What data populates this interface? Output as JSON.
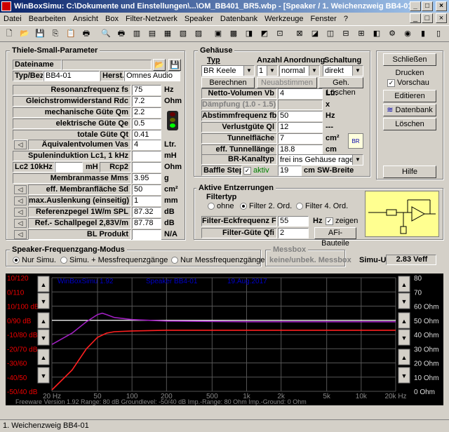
{
  "window": {
    "title": "WinBoxSimu: C:\\Dokumente und Einstellungen\\...\\OM_BB401_BR5.wbp - [Speaker / 1. Weichenzweig BB4-01]"
  },
  "menu": [
    "Datei",
    "Bearbeiten",
    "Ansicht",
    "Box",
    "Filter-Netzwerk",
    "Speaker",
    "Datenbank",
    "Werkzeuge",
    "Fenster",
    "?"
  ],
  "ts": {
    "title": "Thiele-Small-Parameter",
    "dateiname_label": "Dateiname",
    "typ_label": "Typ/Bez.",
    "typ_value": "BB4-01",
    "herst_label": "Herst.",
    "herst_value": "Omnes Audio",
    "rows": [
      {
        "label": "Resonanzfrequenz fs",
        "value": "75",
        "unit": "Hz"
      },
      {
        "label": "Gleichstromwiderstand Rdc",
        "value": "7.2",
        "unit": "Ohm"
      },
      {
        "label": "mechanische Güte Qm",
        "value": "2.2",
        "unit": ""
      },
      {
        "label": "elektrische Güte Qe",
        "value": "0.5",
        "unit": ""
      },
      {
        "label": "totale Güte Qt",
        "value": "0.41",
        "unit": ""
      },
      {
        "label": "Äquivalentvolumen Vas",
        "value": "4",
        "unit": "Ltr."
      },
      {
        "label": "Spuleninduktion  Lc1, 1 kHz",
        "value": "",
        "unit": "mH"
      },
      {
        "label": "Membranmasse Mms",
        "value": "3.95",
        "unit": "g"
      },
      {
        "label": "eff. Membranfläche  Sd",
        "value": "50",
        "unit": "cm²"
      },
      {
        "label": "max.Auslenkung (einseitig) Xmax.",
        "value": "1",
        "unit": "mm"
      },
      {
        "label": "Referenzpegel 1W/m SPL",
        "value": "87.32",
        "unit": "dB"
      },
      {
        "label": "Ref.- Schallpegel 2,83V/m",
        "value": "87.78",
        "unit": "dB"
      },
      {
        "label": "BL Produkt",
        "value": "",
        "unit": "N/A"
      }
    ],
    "lc2_label": "Lc2 10kHz",
    "lc2_unit": "mH",
    "rcp2_label": "Rcp2",
    "rcp2_unit": "Ohm"
  },
  "gh": {
    "title": "Gehäuse",
    "typ_label": "Typ",
    "anzahl_label": "Anzahl",
    "anordnung_label": "Anordnung",
    "schaltung_label": "Schaltung",
    "typ_value": "BR Keele teilak",
    "anzahl_value": "1",
    "anordnung_value": "normal",
    "schaltung_value": "direkt",
    "berechnen": "Berechnen",
    "neuabstimmen": "Neuabstimmen",
    "loeschen": "Geh. Löschen",
    "rows": [
      {
        "label": "Netto-Volumen Vb",
        "value": "4",
        "unit": "Ltr."
      },
      {
        "label": "Dämpfung (1.0 - 1.5)",
        "value": "",
        "unit": "x"
      },
      {
        "label": "Abstimmfrequenz fb",
        "value": "50",
        "unit": "Hz"
      },
      {
        "label": "Verlustgüte Ql",
        "value": "12",
        "unit": "---"
      },
      {
        "label": "Tunnelfläche",
        "value": "7",
        "unit": "cm²"
      },
      {
        "label": "eff. Tunnellänge",
        "value": "18.8",
        "unit": "cm"
      }
    ],
    "kanaltyp_label": "BR-Kanaltyp",
    "kanaltyp_value": "frei ins Gehäuse ragend",
    "baffle_label": "Baffle Step",
    "aktiv_label": "aktiv",
    "baffle_value": "19",
    "baffle_unit": "cm SW-Breite"
  },
  "side": {
    "schliessen": "Schließen",
    "drucken": "Drucken",
    "vorschau": "Vorschau",
    "editieren": "Editieren",
    "datenbank": "Datenbank",
    "loeschen": "Löschen",
    "hilfe": "Hilfe"
  },
  "ae": {
    "title": "Aktive Entzerrungen",
    "filtertyp": "Filtertyp",
    "opts": [
      "ohne",
      "Filter 2. Ord.",
      "Filter 4. Ord."
    ],
    "eck_label": "Filter-Eckfrequenz Ffi",
    "eck_value": "55",
    "eck_unit": "Hz",
    "zeigen": "zeigen",
    "guete_label": "Filter-Güte Qfi",
    "guete_value": "2",
    "afi": "AFi-Bauteile"
  },
  "mode": {
    "title": "Speaker-Frequenzgang-Modus",
    "opts": [
      "Nur Simu.",
      "Simu. + Messfrequenzgänge",
      "Nur Messfrequenzgänge"
    ],
    "messbox_title": "Messbox",
    "messbox_value": "keine/unbek. Messbox",
    "simu_label": "Simu-U",
    "simu_value": "2.83 Veff"
  },
  "chart_data": {
    "type": "line",
    "title": "WinBoxSimu 1.92",
    "speaker_label": "Speaker BB4-01",
    "date": "19.Aug.2017",
    "x_ticks": [
      "20 Hz",
      "50",
      "100",
      "200",
      "500",
      "1k",
      "2k",
      "5k",
      "10k",
      "20k Hz"
    ],
    "x_tick_values": [
      20,
      50,
      100,
      200,
      500,
      1000,
      2000,
      5000,
      10000,
      20000
    ],
    "y_left_ticks": [
      "10/120",
      "0/110",
      "10/100 dB",
      "0/90 dB",
      "-10/80 dB",
      "-20/70 dB",
      "-30/60",
      "-40/50",
      "-50/40 dB"
    ],
    "y_right_ticks": [
      "80",
      "70",
      "60 Ohm",
      "50 Ohm",
      "40 Ohm",
      "30 Ohm",
      "20 Ohm",
      "10 Ohm",
      "0 Ohm"
    ],
    "xlim": [
      20,
      20000
    ],
    "ylim": [
      40,
      120
    ],
    "series": [
      {
        "color": "#ff2020",
        "x": [
          20,
          30,
          40,
          50,
          60,
          70,
          100,
          200,
          500,
          1000,
          20000
        ],
        "y": [
          41,
          55,
          70,
          78,
          81,
          82,
          82.5,
          83,
          83,
          83,
          83
        ]
      },
      {
        "color": "#a020c0",
        "x": [
          20,
          30,
          40,
          50,
          55,
          60,
          70,
          100,
          200,
          1000,
          20000
        ],
        "y": [
          73,
          81,
          89,
          94,
          95,
          94,
          92,
          90.5,
          89.5,
          89,
          89
        ]
      }
    ],
    "footer": "Freeware Version 1.92  Range: 80 dB  Groundlevel: -50/40 dB  Imp.-Range: 80 Ohm  Imp.-Ground: 0 Ohm"
  },
  "status": "1. Weichenzweig BB4-01"
}
